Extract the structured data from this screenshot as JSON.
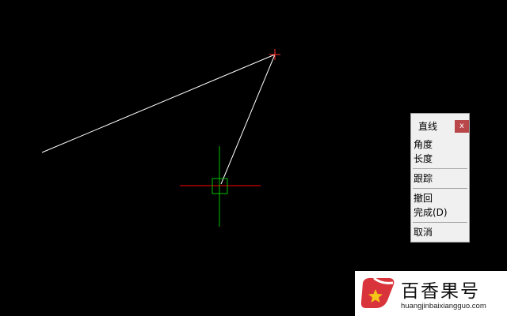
{
  "colors": {
    "canvas_background": "#000000",
    "line": "#ffffff",
    "crosshair_horizontal": "#ff0000",
    "crosshair_vertical": "#00c000",
    "close_button": "#b9474a"
  },
  "context_menu": {
    "title": "直线",
    "close_label": "x",
    "items": [
      "角度",
      "长度",
      "跟踪",
      "撤回",
      "完成(D)",
      "取消"
    ]
  },
  "watermark": {
    "name": "百香果号",
    "url": "huangjinbaixiangguo.com",
    "logo_icon": "star-in-hand-logo"
  }
}
